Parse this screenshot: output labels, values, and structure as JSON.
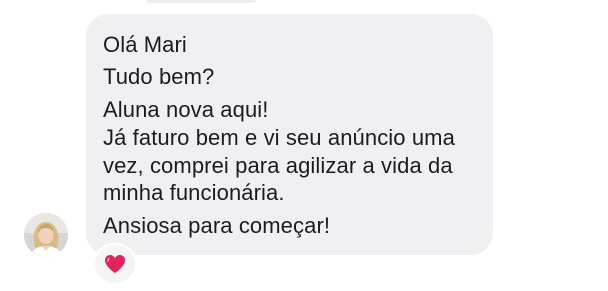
{
  "message": {
    "lines": [
      "Olá Mari",
      "Tudo bem?",
      "Aluna nova aqui!",
      "Já faturo bem e vi seu anúncio uma",
      "vez, comprei para agilizar a vida da",
      "minha funcionária.",
      "Ansiosa para começar!"
    ],
    "reaction_icon": "red-heart-icon",
    "avatar_icon": "sender-avatar-photo"
  },
  "colors": {
    "bubble": "#f0f0f2",
    "text": "#1c1c1e",
    "heart": "#e0245e"
  }
}
